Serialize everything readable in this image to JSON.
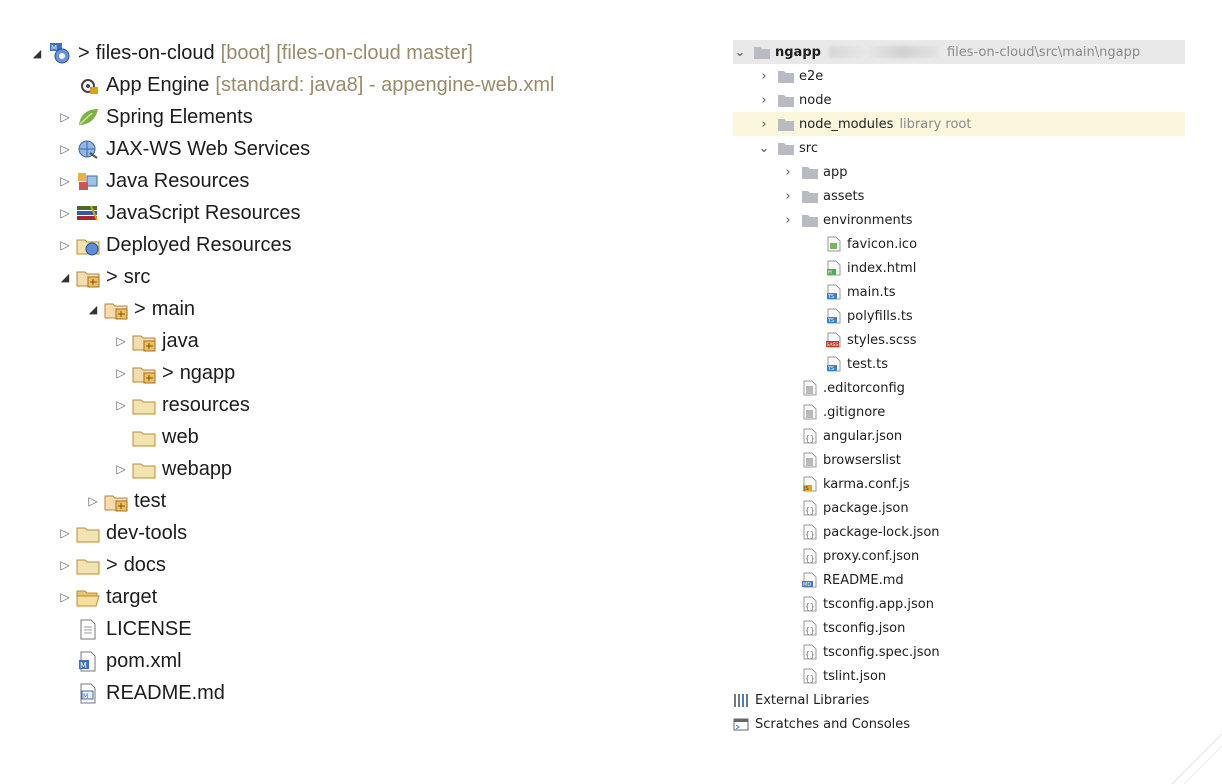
{
  "eclipse": {
    "rows": [
      {
        "name": "files-on-cloud",
        "prefix": ">",
        "label": "files-on-cloud",
        "suffix": "[boot] [files-on-cloud master]",
        "arrow": "open",
        "icon": "maven-project-icon"
      },
      {
        "name": "app-engine",
        "prefix": "",
        "label": "App Engine",
        "suffix": "[standard: java8] - appengine-web.xml",
        "arrow": "none",
        "icon": "app-engine-icon"
      },
      {
        "name": "spring-elements",
        "prefix": "",
        "label": "Spring Elements",
        "suffix": "",
        "arrow": "closed",
        "icon": "spring-leaf-icon"
      },
      {
        "name": "jax-ws",
        "prefix": "",
        "label": "JAX-WS Web Services",
        "suffix": "",
        "arrow": "closed",
        "icon": "web-services-icon"
      },
      {
        "name": "java-resources",
        "prefix": "",
        "label": "Java Resources",
        "suffix": "",
        "arrow": "closed",
        "icon": "java-resources-icon"
      },
      {
        "name": "javascript-resources",
        "prefix": "",
        "label": "JavaScript Resources",
        "suffix": "",
        "arrow": "closed",
        "icon": "javascript-resources-icon"
      },
      {
        "name": "deployed-resources",
        "prefix": "",
        "label": "Deployed Resources",
        "suffix": "",
        "arrow": "closed",
        "icon": "deployed-resources-icon"
      },
      {
        "name": "src",
        "prefix": ">",
        "label": "src",
        "suffix": "",
        "arrow": "open",
        "icon": "git-folder-icon"
      },
      {
        "name": "main",
        "prefix": ">",
        "label": "main",
        "suffix": "",
        "arrow": "open",
        "icon": "git-folder-icon"
      },
      {
        "name": "java",
        "prefix": "",
        "label": "java",
        "suffix": "",
        "arrow": "closed",
        "icon": "git-folder-icon"
      },
      {
        "name": "ngapp",
        "prefix": ">",
        "label": "ngapp",
        "suffix": "",
        "arrow": "closed",
        "icon": "git-folder-icon"
      },
      {
        "name": "resources",
        "prefix": "",
        "label": "resources",
        "suffix": "",
        "arrow": "closed",
        "icon": "folder-icon"
      },
      {
        "name": "web",
        "prefix": "",
        "label": "web",
        "suffix": "",
        "arrow": "none",
        "icon": "folder-icon"
      },
      {
        "name": "webapp",
        "prefix": "",
        "label": "webapp",
        "suffix": "",
        "arrow": "closed",
        "icon": "folder-icon"
      },
      {
        "name": "test",
        "prefix": "",
        "label": "test",
        "suffix": "",
        "arrow": "closed",
        "icon": "git-folder-icon"
      },
      {
        "name": "dev-tools",
        "prefix": "",
        "label": "dev-tools",
        "suffix": "",
        "arrow": "closed",
        "icon": "folder-icon"
      },
      {
        "name": "docs",
        "prefix": ">",
        "label": "docs",
        "suffix": "",
        "arrow": "closed",
        "icon": "folder-icon"
      },
      {
        "name": "target",
        "prefix": "",
        "label": "target",
        "suffix": "",
        "arrow": "closed",
        "icon": "folder-open-icon"
      },
      {
        "name": "license",
        "prefix": "",
        "label": "LICENSE",
        "suffix": "",
        "arrow": "none",
        "icon": "text-file-icon"
      },
      {
        "name": "pom",
        "prefix": "",
        "label": "pom.xml",
        "suffix": "",
        "arrow": "none",
        "icon": "maven-pom-icon"
      },
      {
        "name": "readme",
        "prefix": "",
        "label": "README.md",
        "suffix": "",
        "arrow": "none",
        "icon": "markdown-file-icon"
      }
    ]
  },
  "idea": {
    "root": {
      "label": "ngapp",
      "path": "files-on-cloud\\src\\main\\ngapp"
    },
    "rows": [
      {
        "name": "e2e",
        "label": "e2e",
        "hint": "",
        "arrow": "closed",
        "icon": "folder-icon"
      },
      {
        "name": "node",
        "label": "node",
        "hint": "",
        "arrow": "closed",
        "icon": "folder-icon"
      },
      {
        "name": "node-modules",
        "label": "node_modules",
        "hint": "library root",
        "arrow": "closed",
        "icon": "folder-icon"
      },
      {
        "name": "src",
        "label": "src",
        "hint": "",
        "arrow": "open",
        "icon": "folder-icon"
      },
      {
        "name": "app",
        "label": "app",
        "hint": "",
        "arrow": "closed",
        "icon": "folder-icon"
      },
      {
        "name": "assets",
        "label": "assets",
        "hint": "",
        "arrow": "closed",
        "icon": "folder-icon"
      },
      {
        "name": "environments",
        "label": "environments",
        "hint": "",
        "arrow": "closed",
        "icon": "folder-icon"
      },
      {
        "name": "favicon",
        "label": "favicon.ico",
        "hint": "",
        "arrow": "none",
        "icon": "image-file-icon"
      },
      {
        "name": "index-html",
        "label": "index.html",
        "hint": "",
        "arrow": "none",
        "icon": "html-file-icon"
      },
      {
        "name": "main-ts",
        "label": "main.ts",
        "hint": "",
        "arrow": "none",
        "icon": "ts-file-icon"
      },
      {
        "name": "polyfills-ts",
        "label": "polyfills.ts",
        "hint": "",
        "arrow": "none",
        "icon": "ts-file-icon"
      },
      {
        "name": "styles-scss",
        "label": "styles.scss",
        "hint": "",
        "arrow": "none",
        "icon": "sass-file-icon"
      },
      {
        "name": "test-ts",
        "label": "test.ts",
        "hint": "",
        "arrow": "none",
        "icon": "ts-file-icon"
      },
      {
        "name": "editorconfig",
        "label": ".editorconfig",
        "hint": "",
        "arrow": "none",
        "icon": "text-file-icon"
      },
      {
        "name": "gitignore",
        "label": ".gitignore",
        "hint": "",
        "arrow": "none",
        "icon": "text-file-icon"
      },
      {
        "name": "angular-json",
        "label": "angular.json",
        "hint": "",
        "arrow": "none",
        "icon": "json-file-icon"
      },
      {
        "name": "browserslist",
        "label": "browserslist",
        "hint": "",
        "arrow": "none",
        "icon": "text-file-icon"
      },
      {
        "name": "karma-conf",
        "label": "karma.conf.js",
        "hint": "",
        "arrow": "none",
        "icon": "js-file-icon"
      },
      {
        "name": "package-json",
        "label": "package.json",
        "hint": "",
        "arrow": "none",
        "icon": "json-file-icon"
      },
      {
        "name": "package-lock",
        "label": "package-lock.json",
        "hint": "",
        "arrow": "none",
        "icon": "json-file-icon"
      },
      {
        "name": "proxy-conf",
        "label": "proxy.conf.json",
        "hint": "",
        "arrow": "none",
        "icon": "json-file-icon"
      },
      {
        "name": "readme",
        "label": "README.md",
        "hint": "",
        "arrow": "none",
        "icon": "md-file-icon"
      },
      {
        "name": "tsconfig-app",
        "label": "tsconfig.app.json",
        "hint": "",
        "arrow": "none",
        "icon": "json-file-icon"
      },
      {
        "name": "tsconfig",
        "label": "tsconfig.json",
        "hint": "",
        "arrow": "none",
        "icon": "json-file-icon"
      },
      {
        "name": "tsconfig-spec",
        "label": "tsconfig.spec.json",
        "hint": "",
        "arrow": "none",
        "icon": "json-file-icon"
      },
      {
        "name": "tslint",
        "label": "tslint.json",
        "hint": "",
        "arrow": "none",
        "icon": "json-file-icon"
      },
      {
        "name": "external-libraries",
        "label": "External Libraries",
        "hint": "",
        "arrow": "none",
        "icon": "libraries-icon"
      },
      {
        "name": "scratches",
        "label": "Scratches and Consoles",
        "hint": "",
        "arrow": "none",
        "icon": "scratches-icon"
      }
    ]
  }
}
